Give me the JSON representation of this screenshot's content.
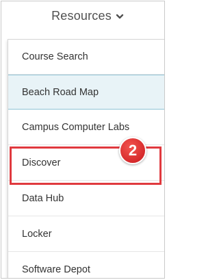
{
  "nav": {
    "label": "Resources",
    "chevron_icon": "chevron-down-icon"
  },
  "menu": {
    "items": [
      {
        "label": "Course Search"
      },
      {
        "label": "Beach Road Map",
        "highlighted": true
      },
      {
        "label": "Campus Computer Labs"
      },
      {
        "label": "Discover",
        "annotated": true
      },
      {
        "label": "Data Hub"
      },
      {
        "label": "Locker"
      },
      {
        "label": "Software Depot"
      }
    ]
  },
  "annotation": {
    "step_number": "2",
    "color": "#e0393e"
  },
  "colors": {
    "highlight_bg": "#e8f3f7",
    "highlight_border": "#8fc3d6",
    "text": "#333333"
  }
}
